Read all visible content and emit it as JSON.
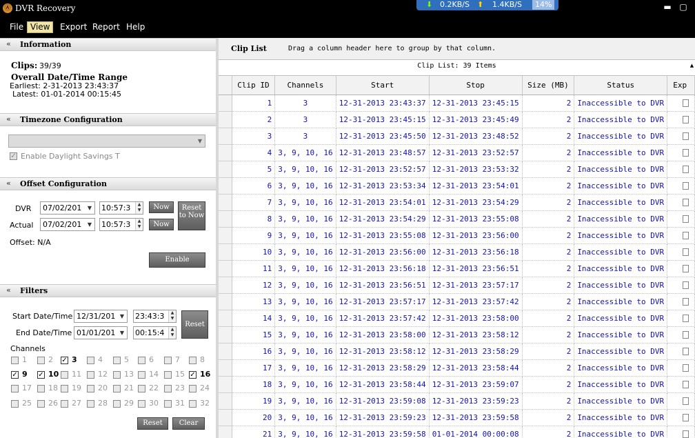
{
  "window": {
    "title": "DVR Recovery",
    "minimize_glyph": "▬",
    "restore_glyph": "▢",
    "app_icon_glyph": "Ⓐ"
  },
  "net": {
    "down": "0.2KB/S",
    "up": "1.4KB/S",
    "percent": "14%",
    "down_arrow": "⬇",
    "up_arrow": "⬆"
  },
  "menu": [
    "File",
    "View",
    "Export",
    "Report",
    "Help"
  ],
  "information": {
    "header": "Information",
    "clips_label": "Clips:",
    "clips_value": "39/39",
    "range_label": "Overall Date/Time Range",
    "earliest": "Earliest: 2-31-2013 23:43:37",
    "latest": "Latest: 01-01-2014 00:15:45"
  },
  "timezone": {
    "header": "Timezone Configuration",
    "selected": "",
    "dst_label": "Enable Daylight Savings T"
  },
  "offset": {
    "header": "Offset Configuration",
    "dvr_label": "DVR",
    "actual_label": "Actual",
    "dvr_date": "07/02/201",
    "dvr_time": "10:57:3",
    "actual_date": "07/02/201",
    "actual_time": "10:57:3",
    "now_label": "Now",
    "reset_now_label": "Reset to Now",
    "offset_text": "Offset: N/A",
    "enable_label": "Enable"
  },
  "filters": {
    "header": "Filters",
    "start_label": "Start Date/Time",
    "end_label": "End Date/Time",
    "start_date": "12/31/201",
    "start_time": "23:43:3",
    "end_date": "01/01/201",
    "end_time": "00:15:4",
    "reset_label": "Reset",
    "channels_label": "Channels",
    "channels": [
      {
        "n": "1",
        "on": false
      },
      {
        "n": "2",
        "on": false
      },
      {
        "n": "3",
        "on": true
      },
      {
        "n": "4",
        "on": false
      },
      {
        "n": "5",
        "on": false
      },
      {
        "n": "6",
        "on": false
      },
      {
        "n": "7",
        "on": false
      },
      {
        "n": "8",
        "on": false
      },
      {
        "n": "9",
        "on": true
      },
      {
        "n": "10",
        "on": true
      },
      {
        "n": "11",
        "on": false
      },
      {
        "n": "12",
        "on": false
      },
      {
        "n": "13",
        "on": false
      },
      {
        "n": "14",
        "on": false
      },
      {
        "n": "15",
        "on": false
      },
      {
        "n": "16",
        "on": true
      },
      {
        "n": "17",
        "on": false
      },
      {
        "n": "18",
        "on": false
      },
      {
        "n": "19",
        "on": false
      },
      {
        "n": "20",
        "on": false
      },
      {
        "n": "21",
        "on": false
      },
      {
        "n": "22",
        "on": false
      },
      {
        "n": "23",
        "on": false
      },
      {
        "n": "24",
        "on": false
      },
      {
        "n": "25",
        "on": false
      },
      {
        "n": "26",
        "on": false
      },
      {
        "n": "27",
        "on": false
      },
      {
        "n": "28",
        "on": false
      },
      {
        "n": "29",
        "on": false
      },
      {
        "n": "30",
        "on": false
      },
      {
        "n": "31",
        "on": false
      },
      {
        "n": "32",
        "on": false
      }
    ],
    "reset_btn": "Reset",
    "clear_btn": "Clear"
  },
  "cliplist": {
    "title": "Clip List",
    "hint": "Drag a column header here to group by that column.",
    "caption": "Clip List: 39 Items",
    "columns": [
      "Clip ID",
      "Channels",
      "Start",
      "Stop",
      "Size (MB)",
      "Status",
      "Exp"
    ],
    "rows": [
      [
        "1",
        "3",
        "12-31-2013 23:43:37",
        "12-31-2013 23:45:15",
        "2",
        "Inaccessible to DVR"
      ],
      [
        "2",
        "3",
        "12-31-2013 23:45:15",
        "12-31-2013 23:45:49",
        "2",
        "Inaccessible to DVR"
      ],
      [
        "3",
        "3",
        "12-31-2013 23:45:50",
        "12-31-2013 23:48:52",
        "2",
        "Inaccessible to DVR"
      ],
      [
        "4",
        "3, 9, 10, 16",
        "12-31-2013 23:48:57",
        "12-31-2013 23:52:57",
        "2",
        "Inaccessible to DVR"
      ],
      [
        "5",
        "3, 9, 10, 16",
        "12-31-2013 23:52:57",
        "12-31-2013 23:53:32",
        "2",
        "Inaccessible to DVR"
      ],
      [
        "6",
        "3, 9, 10, 16",
        "12-31-2013 23:53:34",
        "12-31-2013 23:54:01",
        "2",
        "Inaccessible to DVR"
      ],
      [
        "7",
        "3, 9, 10, 16",
        "12-31-2013 23:54:01",
        "12-31-2013 23:54:29",
        "2",
        "Inaccessible to DVR"
      ],
      [
        "8",
        "3, 9, 10, 16",
        "12-31-2013 23:54:29",
        "12-31-2013 23:55:08",
        "2",
        "Inaccessible to DVR"
      ],
      [
        "9",
        "3, 9, 10, 16",
        "12-31-2013 23:55:08",
        "12-31-2013 23:56:00",
        "2",
        "Inaccessible to DVR"
      ],
      [
        "10",
        "3, 9, 10, 16",
        "12-31-2013 23:56:00",
        "12-31-2013 23:56:18",
        "2",
        "Inaccessible to DVR"
      ],
      [
        "11",
        "3, 9, 10, 16",
        "12-31-2013 23:56:18",
        "12-31-2013 23:56:51",
        "2",
        "Inaccessible to DVR"
      ],
      [
        "12",
        "3, 9, 10, 16",
        "12-31-2013 23:56:51",
        "12-31-2013 23:57:17",
        "2",
        "Inaccessible to DVR"
      ],
      [
        "13",
        "3, 9, 10, 16",
        "12-31-2013 23:57:17",
        "12-31-2013 23:57:42",
        "2",
        "Inaccessible to DVR"
      ],
      [
        "14",
        "3, 9, 10, 16",
        "12-31-2013 23:57:42",
        "12-31-2013 23:58:00",
        "2",
        "Inaccessible to DVR"
      ],
      [
        "15",
        "3, 9, 10, 16",
        "12-31-2013 23:58:00",
        "12-31-2013 23:58:12",
        "2",
        "Inaccessible to DVR"
      ],
      [
        "16",
        "3, 9, 10, 16",
        "12-31-2013 23:58:12",
        "12-31-2013 23:58:29",
        "2",
        "Inaccessible to DVR"
      ],
      [
        "17",
        "3, 9, 10, 16",
        "12-31-2013 23:58:29",
        "12-31-2013 23:58:44",
        "2",
        "Inaccessible to DVR"
      ],
      [
        "18",
        "3, 9, 10, 16",
        "12-31-2013 23:58:44",
        "12-31-2013 23:59:07",
        "2",
        "Inaccessible to DVR"
      ],
      [
        "19",
        "3, 9, 10, 16",
        "12-31-2013 23:59:08",
        "12-31-2013 23:59:23",
        "2",
        "Inaccessible to DVR"
      ],
      [
        "20",
        "3, 9, 10, 16",
        "12-31-2013 23:59:23",
        "12-31-2013 23:59:58",
        "2",
        "Inaccessible to DVR"
      ],
      [
        "21",
        "3, 9, 10, 16",
        "12-31-2013 23:59:58",
        "01-01-2014 00:00:08",
        "2",
        "Inaccessible to DVR"
      ]
    ]
  },
  "colors": {
    "link_blue": "#1010c0",
    "netbar_blue": "#2f6fbe",
    "menu_active": "#f1e6a6"
  }
}
